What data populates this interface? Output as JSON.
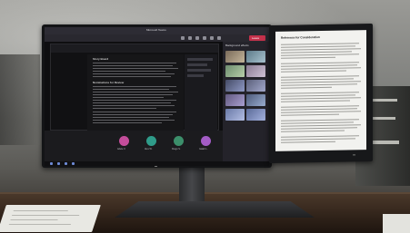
{
  "scene": {
    "description_type": "photo",
    "colors": {
      "bezel": "#131416",
      "teams_leave": "#c4314b",
      "document_page": "#f2f2ef",
      "desk": "#3a2b20"
    }
  },
  "main_monitor": {
    "teams": {
      "window_title": "Microsoft Teams",
      "leave_label": "Leave",
      "background_panel_title": "Background effects",
      "shared_doc": {
        "heading_1": "Story Board",
        "heading_2": "Nominations for Review"
      },
      "participants": [
        {
          "name": "Adele V.",
          "color": "#c44d9b"
        },
        {
          "name": "Alex W.",
          "color": "#2f9c8a"
        },
        {
          "name": "Diego S.",
          "color": "#3c8f6b"
        },
        {
          "name": "Isaiah L.",
          "color": "#a35cc6"
        }
      ]
    }
  },
  "side_monitor": {
    "document": {
      "title": "Reference for Consideration"
    }
  }
}
